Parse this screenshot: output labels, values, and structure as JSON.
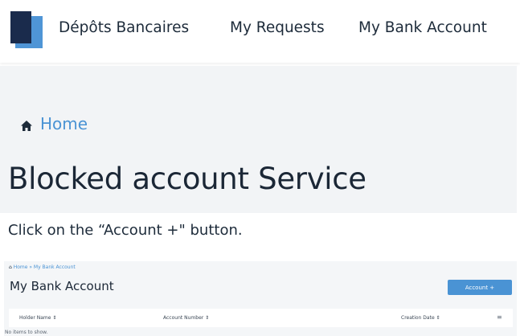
{
  "nav": {
    "items": [
      "Dépôts Bancaires",
      "My Requests",
      "My Bank Account"
    ]
  },
  "hero": {
    "breadcrumb": "Home",
    "title": "Blocked account Service"
  },
  "instruction": "Click on the “Account +\" button.",
  "screenshot": {
    "breadcrumb": "Home » My Bank Account",
    "title": "My Bank Account",
    "account_button": "Account +",
    "columns": [
      "Holder Name ⇕",
      "Account Number ⇕",
      "Creation Date ⇕"
    ],
    "empty_text": "No items to show."
  },
  "colors": {
    "accent": "#4a93d4",
    "logo_dark": "#1a2b4c",
    "logo_light": "#4f95d6",
    "hero_bg": "#f2f4f6"
  }
}
